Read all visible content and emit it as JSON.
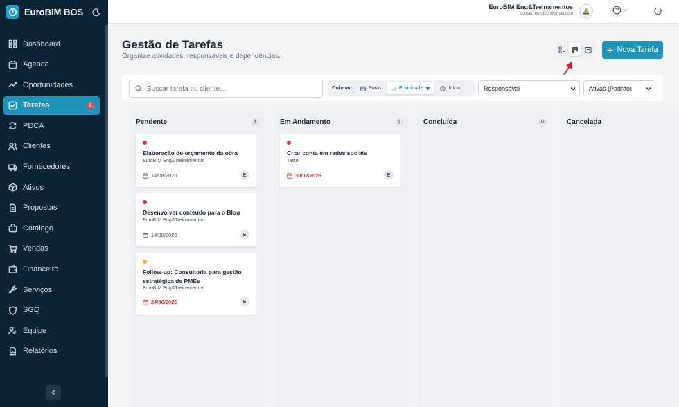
{
  "app": {
    "name": "EuroBIM BOS"
  },
  "colors": {
    "accent": "#1d94b8",
    "sidebar": "#0c2435",
    "high": "#dc3545",
    "medium": "#f0ad2e"
  },
  "sidebar": {
    "items": [
      {
        "label": "Dashboard",
        "icon": "grid-icon"
      },
      {
        "label": "Agenda",
        "icon": "calendar-icon"
      },
      {
        "label": "Oportunidades",
        "icon": "trend-icon"
      },
      {
        "label": "Tarefas",
        "icon": "checklist-icon",
        "active": true,
        "badge": "2"
      },
      {
        "label": "PDCA",
        "icon": "cycle-icon"
      },
      {
        "label": "Clientes",
        "icon": "users-icon"
      },
      {
        "label": "Fornecedores",
        "icon": "truck-icon"
      },
      {
        "label": "Ativos",
        "icon": "box-icon"
      },
      {
        "label": "Propostas",
        "icon": "file-icon"
      },
      {
        "label": "Catálogo",
        "icon": "bag-icon"
      },
      {
        "label": "Vendas",
        "icon": "cart-icon"
      },
      {
        "label": "Financeiro",
        "icon": "wallet-icon"
      },
      {
        "label": "Serviços",
        "icon": "wrench-icon"
      },
      {
        "label": "SGQ",
        "icon": "shield-icon"
      },
      {
        "label": "Equipe",
        "icon": "team-icon"
      },
      {
        "label": "Relatórios",
        "icon": "report-icon"
      }
    ]
  },
  "header": {
    "company": "EuroBIM Eng&Treinamentos",
    "email": "contato.eurobim@gmail.com"
  },
  "page": {
    "title": "Gestão de Tarefas",
    "subtitle": "Organize atividades, responsáveis e dependências.",
    "new_button": "Nova Tarefa"
  },
  "toolbar": {
    "search_placeholder": "Buscar tarefa ou cliente...",
    "sort_label": "Ordenar:",
    "sort_options": [
      {
        "label": "Prazo"
      },
      {
        "label": "Prioridade",
        "active": true
      },
      {
        "label": "Início"
      }
    ],
    "responsavel": "Responsável",
    "status_filter": "Ativas (Padrão)"
  },
  "columns": [
    {
      "title": "Pendente",
      "count": "3",
      "cards": [
        {
          "title": "Elaboração de orçamento da obra",
          "client": "EuroBIM Eng&Treinamentos",
          "date": "14/08/2026",
          "overdue": false,
          "priority": "high",
          "assignee": "E"
        },
        {
          "title": "Desenvolver conteúdo para o Blog",
          "client": "EuroBIM Eng&Treinamentos",
          "date": "14/08/2026",
          "overdue": false,
          "priority": "high",
          "assignee": "E"
        },
        {
          "title": "Follow-up: Consultoria para gestão estratégica de PMEs",
          "client": "EuroBIM Eng&Treinamentos",
          "date": "24/06/2026",
          "overdue": true,
          "priority": "medium",
          "assignee": "E"
        }
      ]
    },
    {
      "title": "Em Andamento",
      "count": "1",
      "cards": [
        {
          "title": "Criar conta em redes sociais",
          "client": "Teste",
          "date": "30/07/2026",
          "overdue": true,
          "priority": "high",
          "assignee": "E"
        }
      ]
    },
    {
      "title": "Concluída",
      "count": "0",
      "cards": []
    },
    {
      "title": "Cancelada",
      "count": "",
      "cards": []
    }
  ]
}
